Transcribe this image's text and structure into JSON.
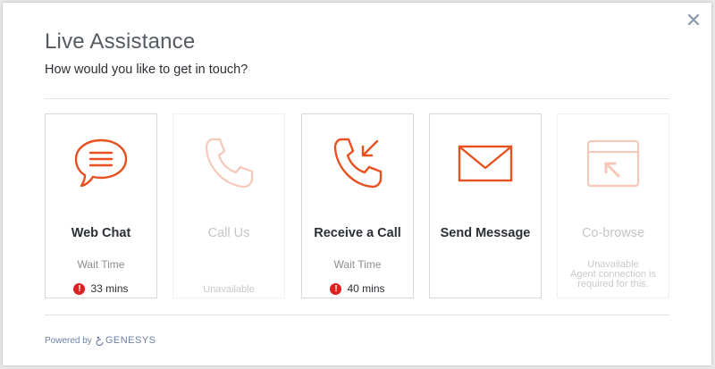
{
  "dialog": {
    "title": "Live Assistance",
    "subtitle": "How would you like to get in touch?",
    "close_icon": "close-icon"
  },
  "cards": [
    {
      "label": "Web Chat",
      "wait_label": "Wait Time",
      "wait_value": "33 mins",
      "status": "available",
      "icon": "chat-bubble-icon"
    },
    {
      "label": "Call Us",
      "unavailable_text": "Unavailable",
      "status": "unavailable",
      "icon": "phone-icon"
    },
    {
      "label": "Receive a Call",
      "wait_label": "Wait Time",
      "wait_value": "40 mins",
      "status": "available",
      "icon": "incoming-call-icon"
    },
    {
      "label": "Send Message",
      "status": "available",
      "icon": "envelope-icon"
    },
    {
      "label": "Co-browse",
      "unavailable_text": "Unavailable",
      "note": "Agent connection is required for this.",
      "status": "unavailable",
      "icon": "cobrowse-window-icon"
    }
  ],
  "footer": {
    "powered_by": "Powered by",
    "brand": "GENESYS"
  },
  "colors": {
    "accent": "#e8501f",
    "accent_disabled": "#f5c8b8",
    "alert": "#e02020",
    "brand": "#6c7fa0"
  }
}
